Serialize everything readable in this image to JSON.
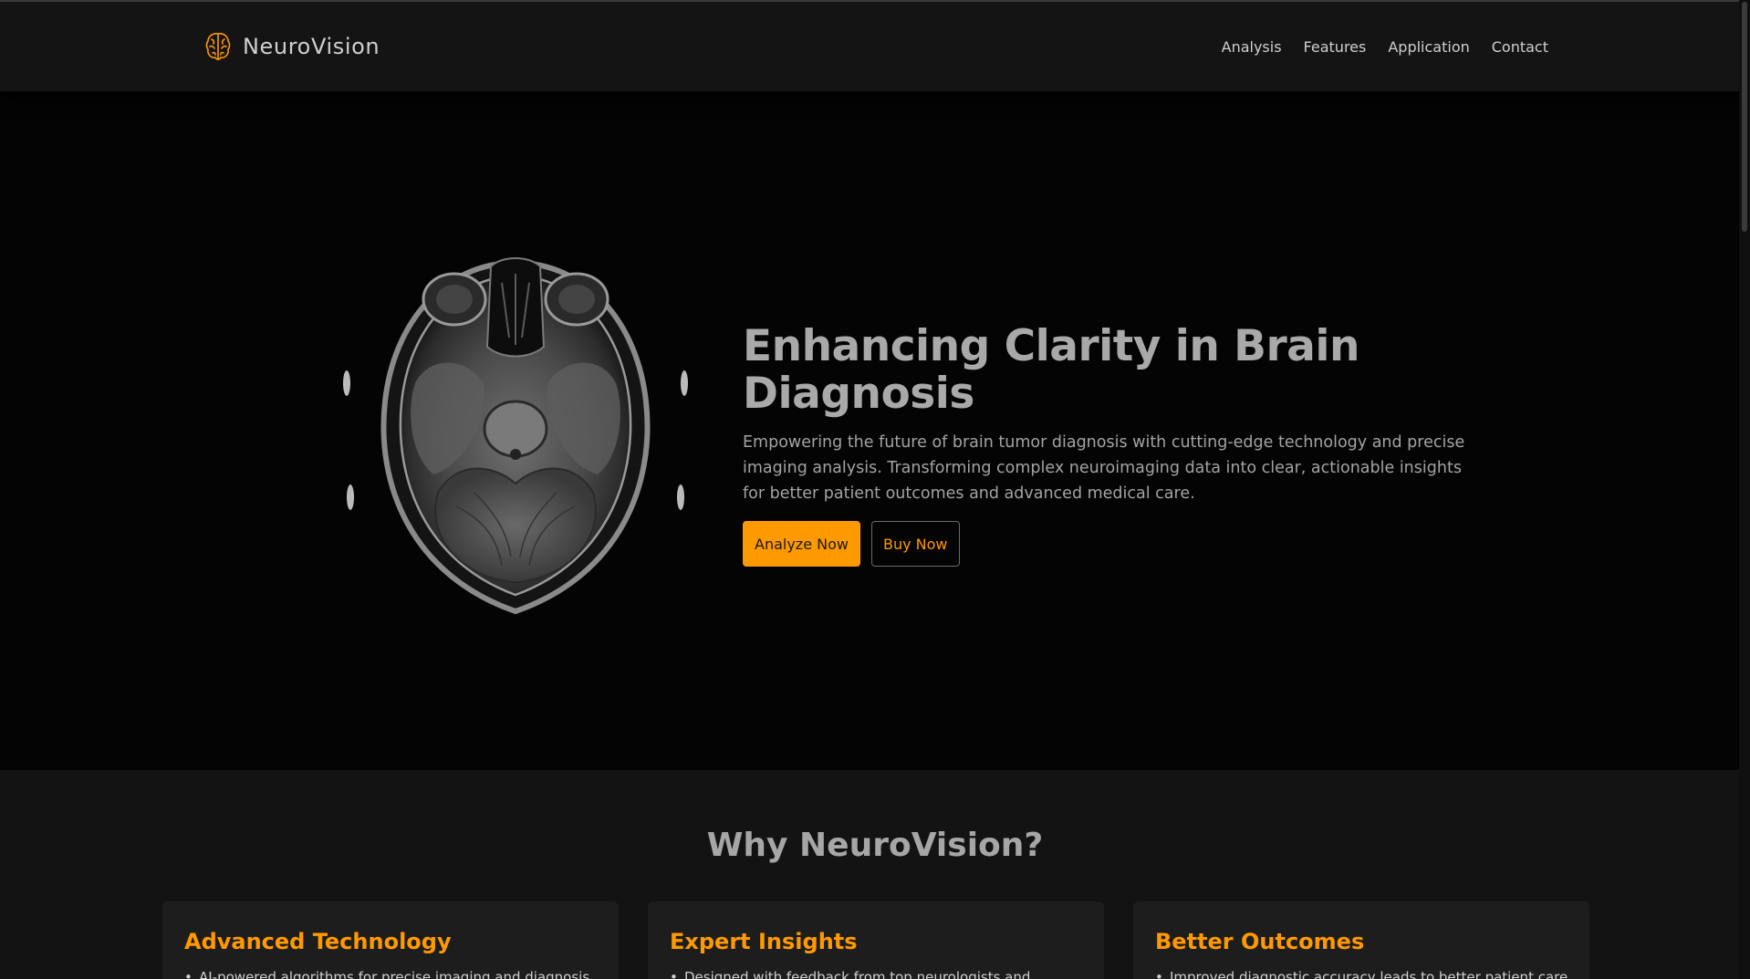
{
  "brand": {
    "name": "NeuroVision",
    "icon": "brain-icon",
    "accent": "#ff9900"
  },
  "nav": {
    "links": [
      {
        "label": "Analysis"
      },
      {
        "label": "Features"
      },
      {
        "label": "Application"
      },
      {
        "label": "Contact"
      }
    ]
  },
  "hero": {
    "title": "Enhancing Clarity in Brain Diagnosis",
    "description": "Empowering the future of brain tumor diagnosis with cutting-edge technology and precise imaging analysis. Transforming complex neuroimaging data into clear, actionable insights for better patient outcomes and advanced medical care.",
    "primary_button": "Analyze Now",
    "secondary_button": "Buy Now",
    "image": "brain-mri-scan"
  },
  "why": {
    "title": "Why NeuroVision?",
    "cards": [
      {
        "title": "Advanced Technology",
        "item": "AI-powered algorithms for precise imaging and diagnosis."
      },
      {
        "title": "Expert Insights",
        "item": "Designed with feedback from top neurologists and"
      },
      {
        "title": "Better Outcomes",
        "item": "Improved diagnostic accuracy leads to better patient care."
      }
    ]
  },
  "colors": {
    "background": "#050505",
    "navbar": "#141414",
    "section": "#131313",
    "card": "#1d1d1d",
    "accent": "#ff9900",
    "text": "#a9a9a9"
  }
}
